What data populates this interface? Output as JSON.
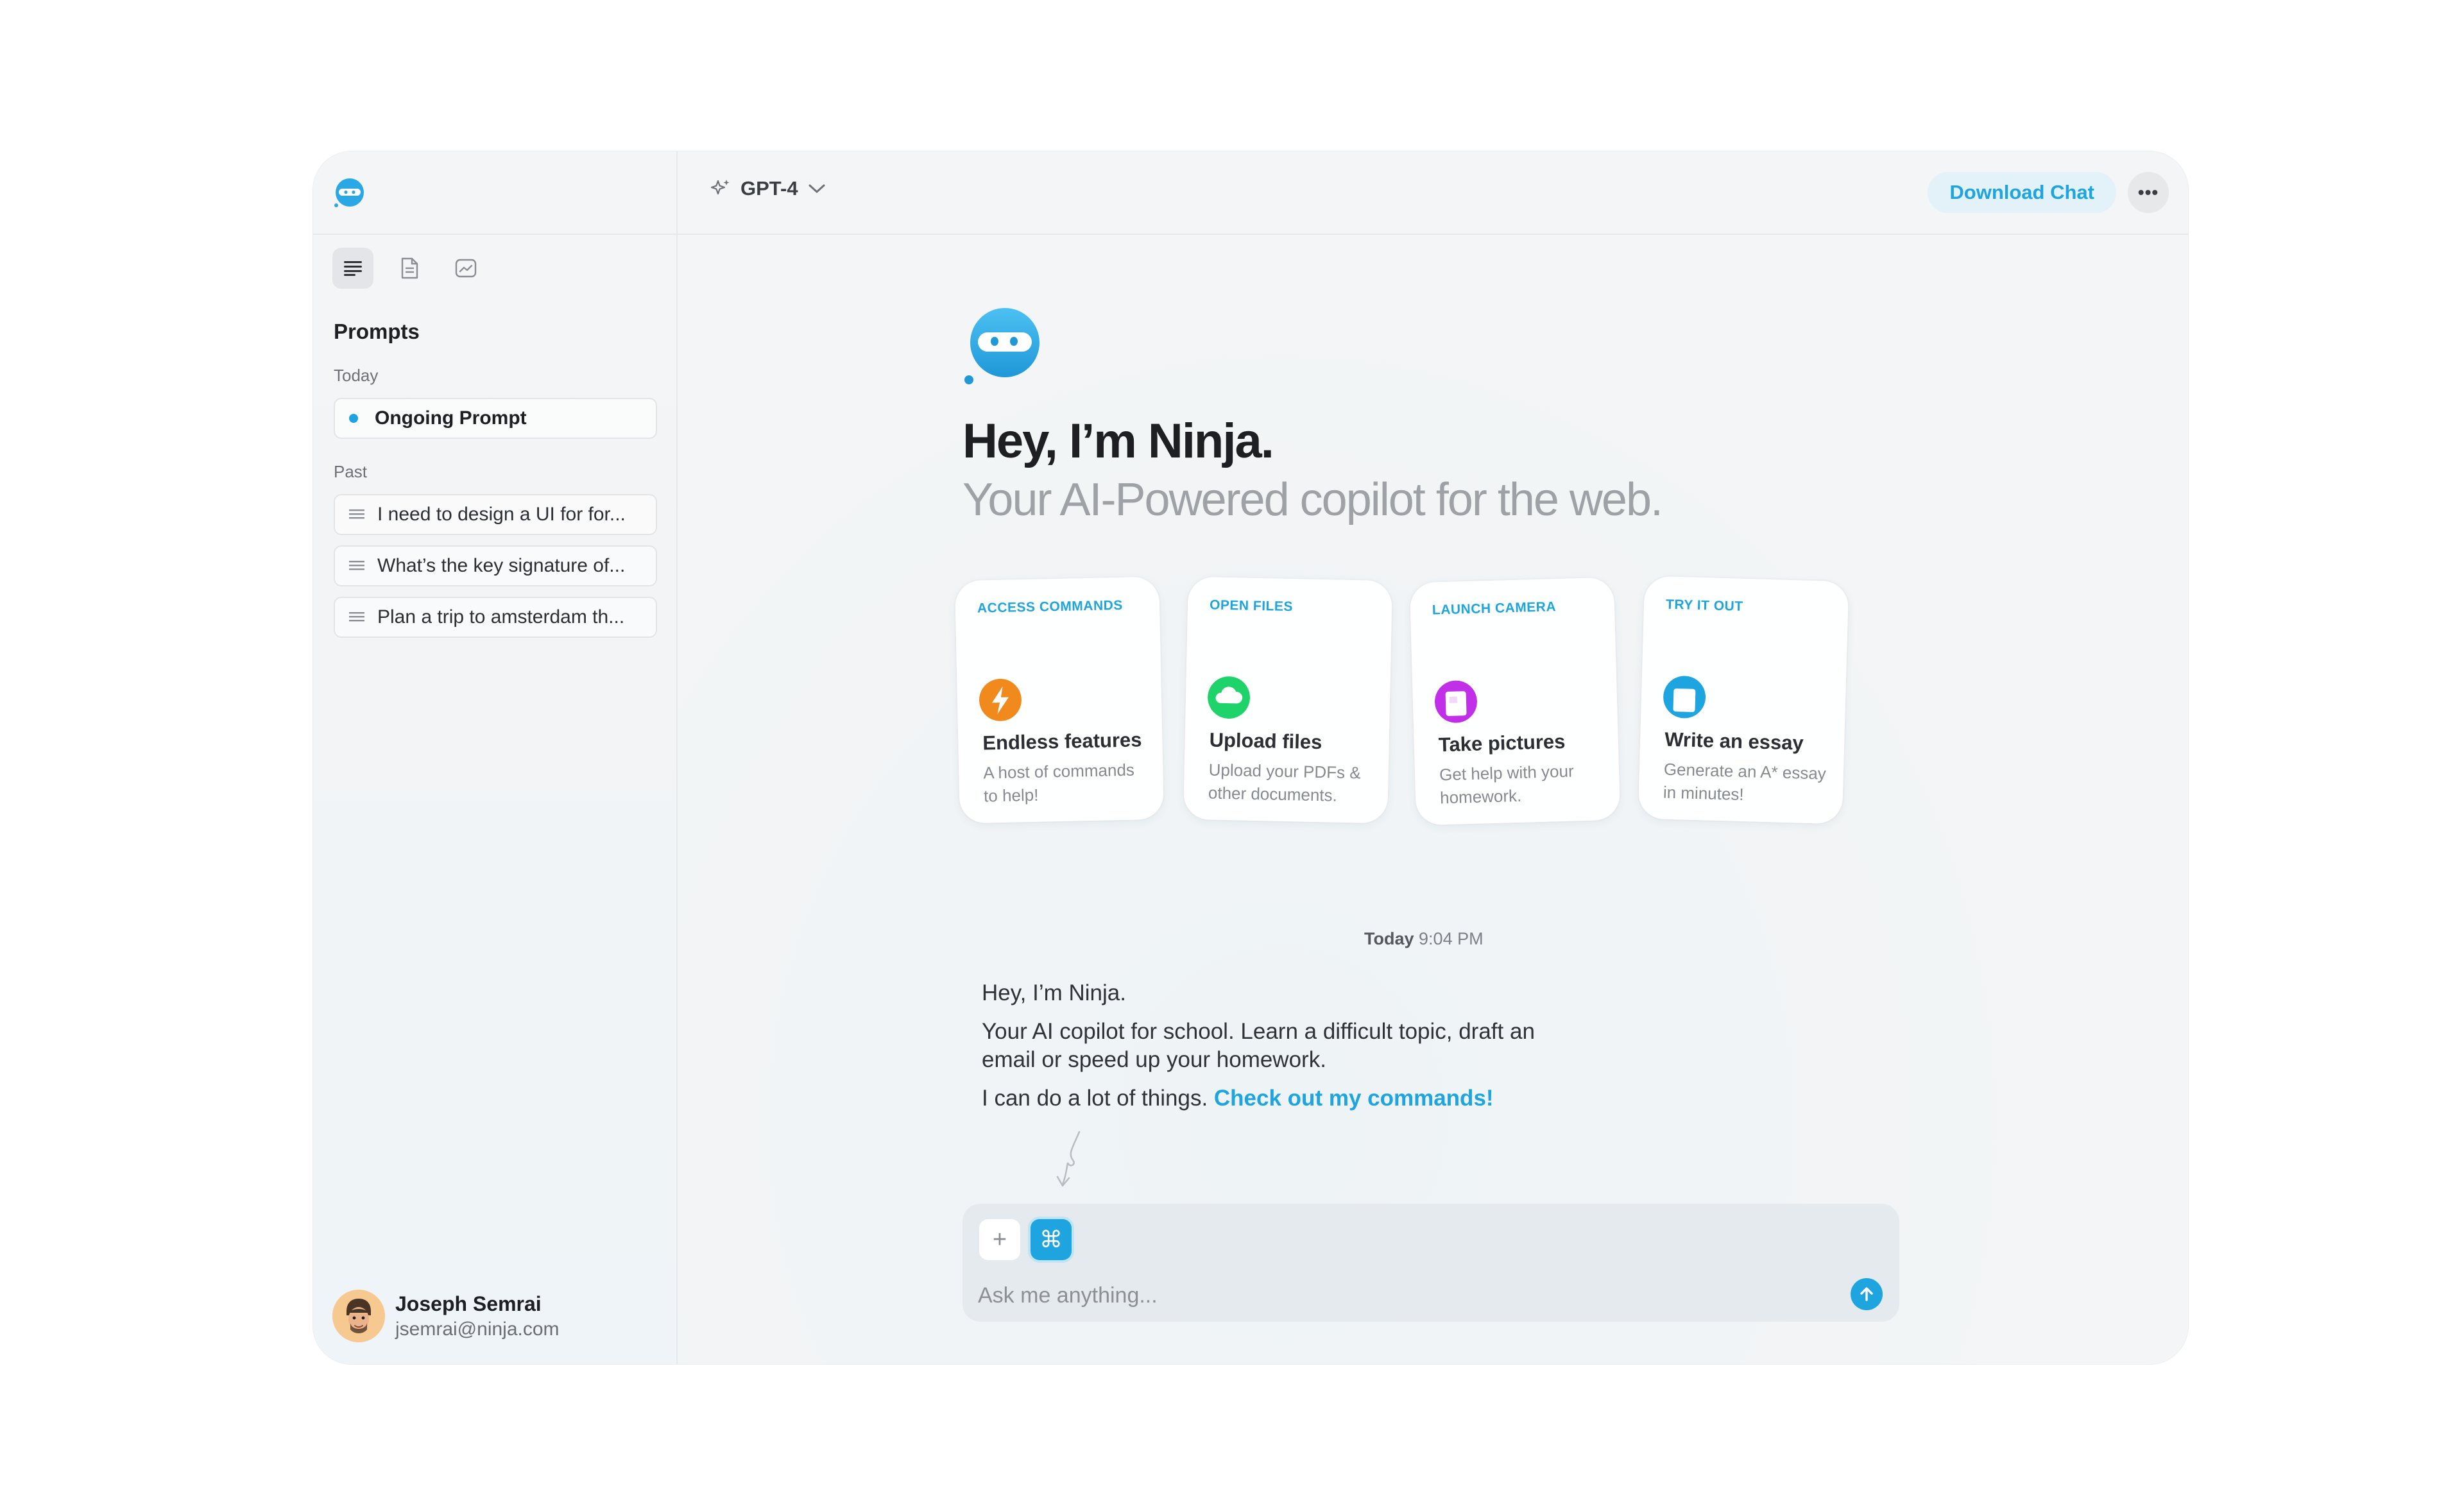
{
  "sidebar": {
    "heading": "Prompts",
    "sections": {
      "today": "Today",
      "past": "Past"
    },
    "ongoing": "Ongoing Prompt",
    "past_items": [
      {
        "label": "I need to design a UI for for..."
      },
      {
        "label": "What’s the key signature of..."
      },
      {
        "label": "Plan a trip to amsterdam th..."
      }
    ],
    "user": {
      "name": "Joseph Semrai",
      "email": "jsemrai@ninja.com"
    }
  },
  "topbar": {
    "model": "GPT-4",
    "download_label": "Download Chat",
    "more_label": "•••"
  },
  "hero": {
    "title": "Hey, I’m Ninja.",
    "subtitle": "Your AI-Powered copilot for the web."
  },
  "cards": [
    {
      "category": "ACCESS COMMANDS",
      "title": "Endless features",
      "desc": "A host of commands to help!",
      "icon": "lightning-icon",
      "color": "#f08a1c"
    },
    {
      "category": "OPEN FILES",
      "title": "Upload files",
      "desc": "Upload your PDFs & other documents.",
      "icon": "cloud-icon",
      "color": "#1fd36b"
    },
    {
      "category": "LAUNCH CAMERA",
      "title": "Take pictures",
      "desc": "Get help with your homework.",
      "icon": "camera-icon",
      "color": "#c12fe8"
    },
    {
      "category": "TRY IT OUT",
      "title": "Write an essay",
      "desc": "Generate an A* essay in minutes!",
      "icon": "document-icon",
      "color": "#1ea4df"
    }
  ],
  "chat": {
    "timestamp_day": "Today",
    "timestamp_time": "9:04 PM",
    "line1": "Hey, I’m Ninja.",
    "line2a": "Your AI copilot for school. Learn a difficult topic, draft an",
    "line2b": "email or speed up your homework.",
    "line3": "I can do a lot of things.",
    "link": "Check out my commands!"
  },
  "composer": {
    "placeholder": "Ask me anything...",
    "plus_label": "+",
    "cmd_label": "⌘"
  },
  "colors": {
    "accent": "#1ea4df"
  }
}
